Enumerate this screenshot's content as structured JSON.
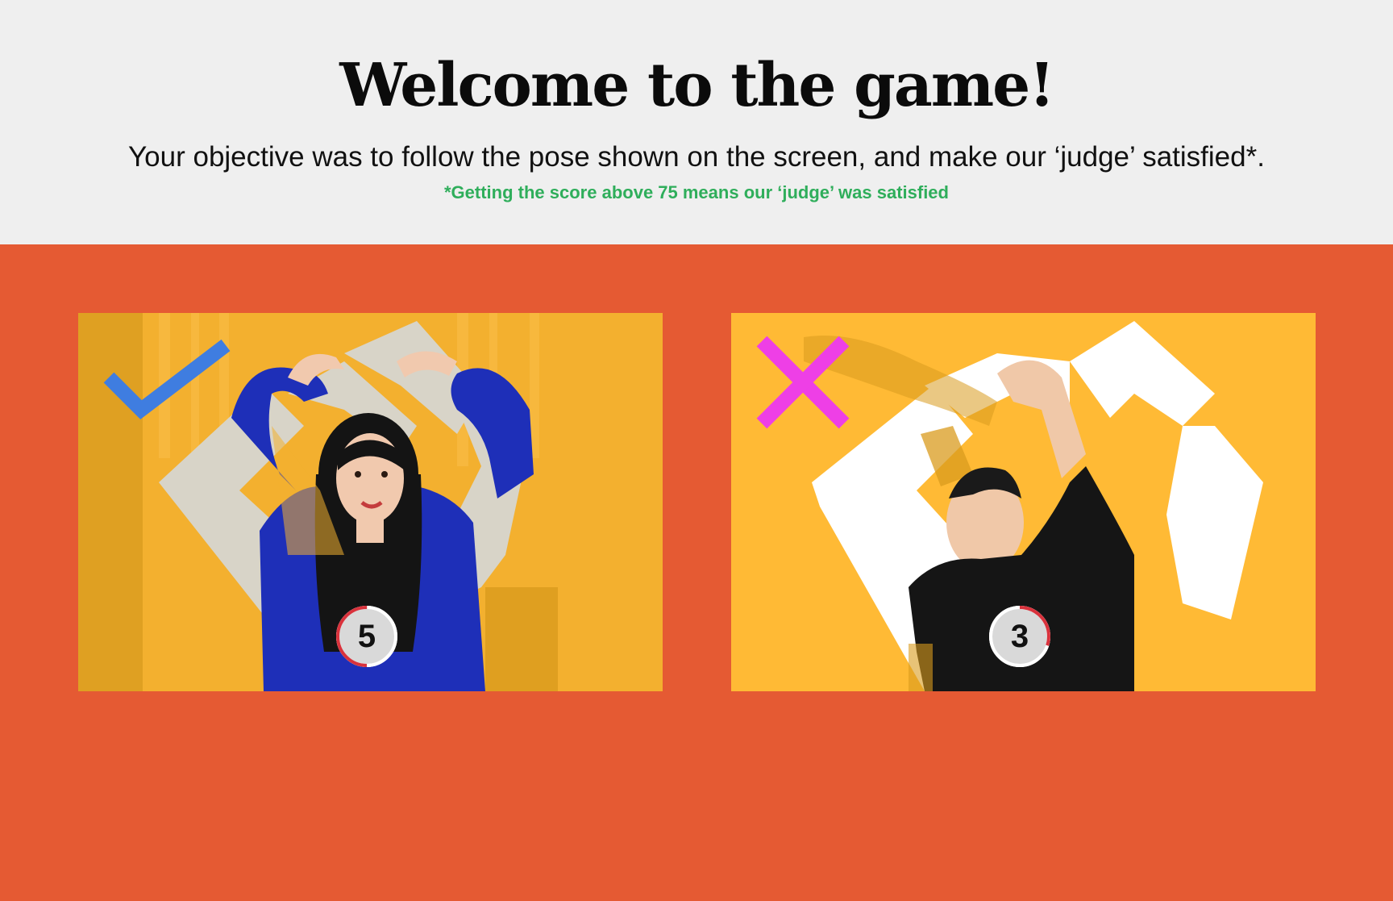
{
  "header": {
    "title": "Welcome to the game!",
    "subtitle": "Your objective was to follow the pose shown on the screen, and make our ‘judge’ satisfied*.",
    "note": "*Getting the score above 75 means our ‘judge’ was satisfied",
    "note_color": "#2fae5b"
  },
  "colors": {
    "header_bg": "#efefef",
    "stage_bg": "#e55a33",
    "card_bg": "#ffba35",
    "check": "#3f7de0",
    "cross": "#ee3fe6"
  },
  "examples": [
    {
      "result": "correct",
      "status_icon": "check-icon",
      "score": "5",
      "progress": 0.5
    },
    {
      "result": "incorrect",
      "status_icon": "cross-icon",
      "score": "3",
      "progress": 0.3
    }
  ]
}
